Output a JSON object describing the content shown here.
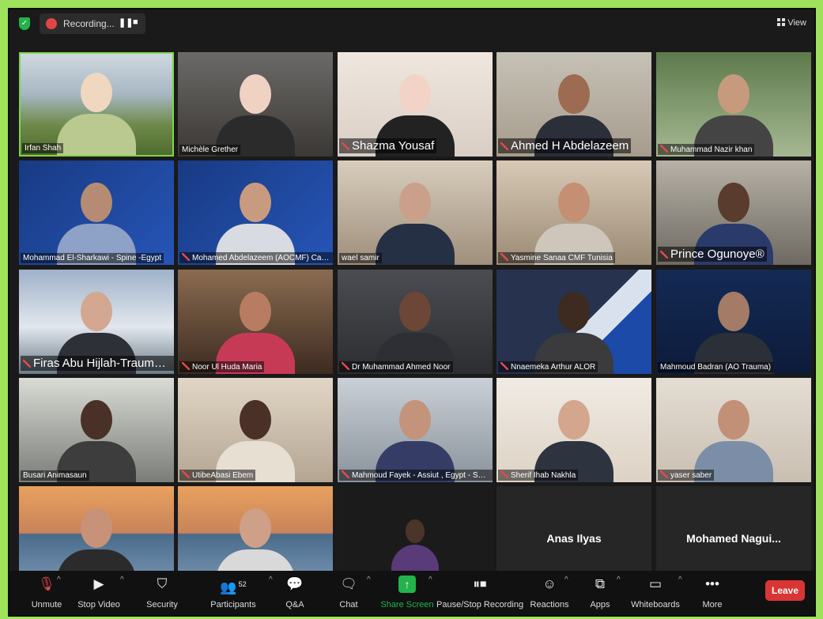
{
  "meeting": {
    "recording_label": "Recording...",
    "pause_glyph": "❚❚",
    "stop_glyph": "■",
    "view_label": "View",
    "shield_icon": "shield-check-icon",
    "record_icon": "record-dot-icon"
  },
  "participants": [
    {
      "name": "Irfan Shah",
      "muted": false,
      "active": true
    },
    {
      "name": "Michèle Grether",
      "muted": false,
      "active": false
    },
    {
      "name": "Shazma Yousaf",
      "muted": true,
      "big": true
    },
    {
      "name": "Ahmed H Abdelazeem",
      "muted": true,
      "big": true
    },
    {
      "name": "Muhammad Nazir khan",
      "muted": true
    },
    {
      "name": "Mohammad El-Sharkawi - Spine -Egypt",
      "muted": false
    },
    {
      "name": "Mohamed Abdelazeem (AOCMF) Cairo Univer...",
      "muted": true
    },
    {
      "name": "wael samir",
      "muted": false
    },
    {
      "name": "Yasmine Sanaa CMF Tunisia",
      "muted": true
    },
    {
      "name": "Prince Ogunoye®",
      "muted": true,
      "big": true
    },
    {
      "name": "Firas Abu Hijlah-Trauma-...",
      "muted": true,
      "big": true
    },
    {
      "name": "Noor Ul Huda Maria",
      "muted": true
    },
    {
      "name": "Dr Muhammad Ahmed Noor",
      "muted": true
    },
    {
      "name": "Nnaemeka Arthur ALOR",
      "muted": true
    },
    {
      "name": "Mahmoud Badran (AO Trauma)",
      "muted": false
    },
    {
      "name": "Busari Animasaun",
      "muted": false
    },
    {
      "name": "UtibeAbasi Ebem",
      "muted": true
    },
    {
      "name": "Mahmoud Fayek - Assiut , Egypt - Spine",
      "muted": true
    },
    {
      "name": "Sherif Ihab Nakhla",
      "muted": true
    },
    {
      "name": "yaser saber",
      "muted": true
    },
    {
      "name": "",
      "muted": false
    },
    {
      "name": "",
      "muted": false
    },
    {
      "name": "",
      "muted": false
    },
    {
      "name": "Anas Ilyas",
      "muted": false,
      "video_off": true
    },
    {
      "name": "Mohamed Nagui...",
      "muted": false,
      "video_off": true
    }
  ],
  "toolbar": {
    "unmute": "Unmute",
    "stop_video": "Stop Video",
    "security": "Security",
    "participants": "Participants",
    "participants_count": "52",
    "qa": "Q&A",
    "chat": "Chat",
    "share_screen": "Share Screen",
    "pause_stop_recording": "Pause/Stop Recording",
    "reactions": "Reactions",
    "apps": "Apps",
    "whiteboards": "Whiteboards",
    "more": "More",
    "leave": "Leave"
  },
  "colors": {
    "page_bg": "#9ee15a",
    "window_bg": "#1a1a1a",
    "active_speaker": "#7fd64a",
    "share_green": "#23b24b",
    "leave_red": "#d93535",
    "muted_red": "#e5484d"
  }
}
